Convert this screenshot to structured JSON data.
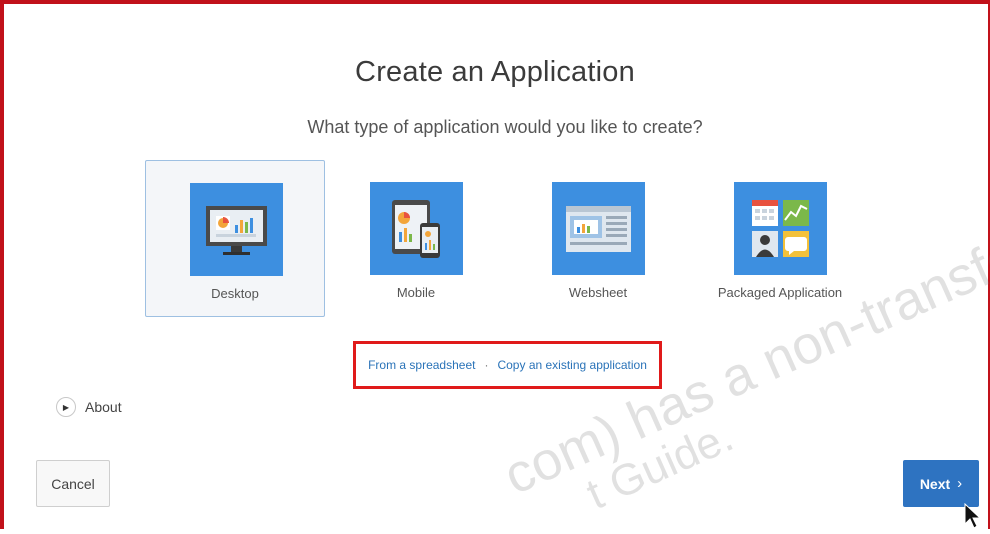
{
  "dialog": {
    "title": "Create an Application",
    "subtitle": "What type of application would you like to create?"
  },
  "types": [
    {
      "label": "Desktop",
      "icon": "desktop-monitor-icon",
      "selected": true
    },
    {
      "label": "Mobile",
      "icon": "mobile-devices-icon",
      "selected": false
    },
    {
      "label": "Websheet",
      "icon": "websheet-icon",
      "selected": false
    },
    {
      "label": "Packaged Application",
      "icon": "packaged-app-icon",
      "selected": false
    }
  ],
  "links": {
    "spreadsheet": "From a spreadsheet",
    "separator": "·",
    "copy": "Copy an existing application"
  },
  "about": {
    "label": "About",
    "icon": "expand-triangle-icon"
  },
  "buttons": {
    "cancel": "Cancel",
    "next": "Next",
    "next_chevron": "›"
  },
  "watermark": {
    "line1": "com) has a non-transfer",
    "line2": "t Guide."
  },
  "colors": {
    "tile": "#3d8fe0",
    "next_button": "#2e73c1",
    "highlight_border": "#e01a1a",
    "selected_border": "#9ec0e2",
    "link": "#2a73b8"
  }
}
